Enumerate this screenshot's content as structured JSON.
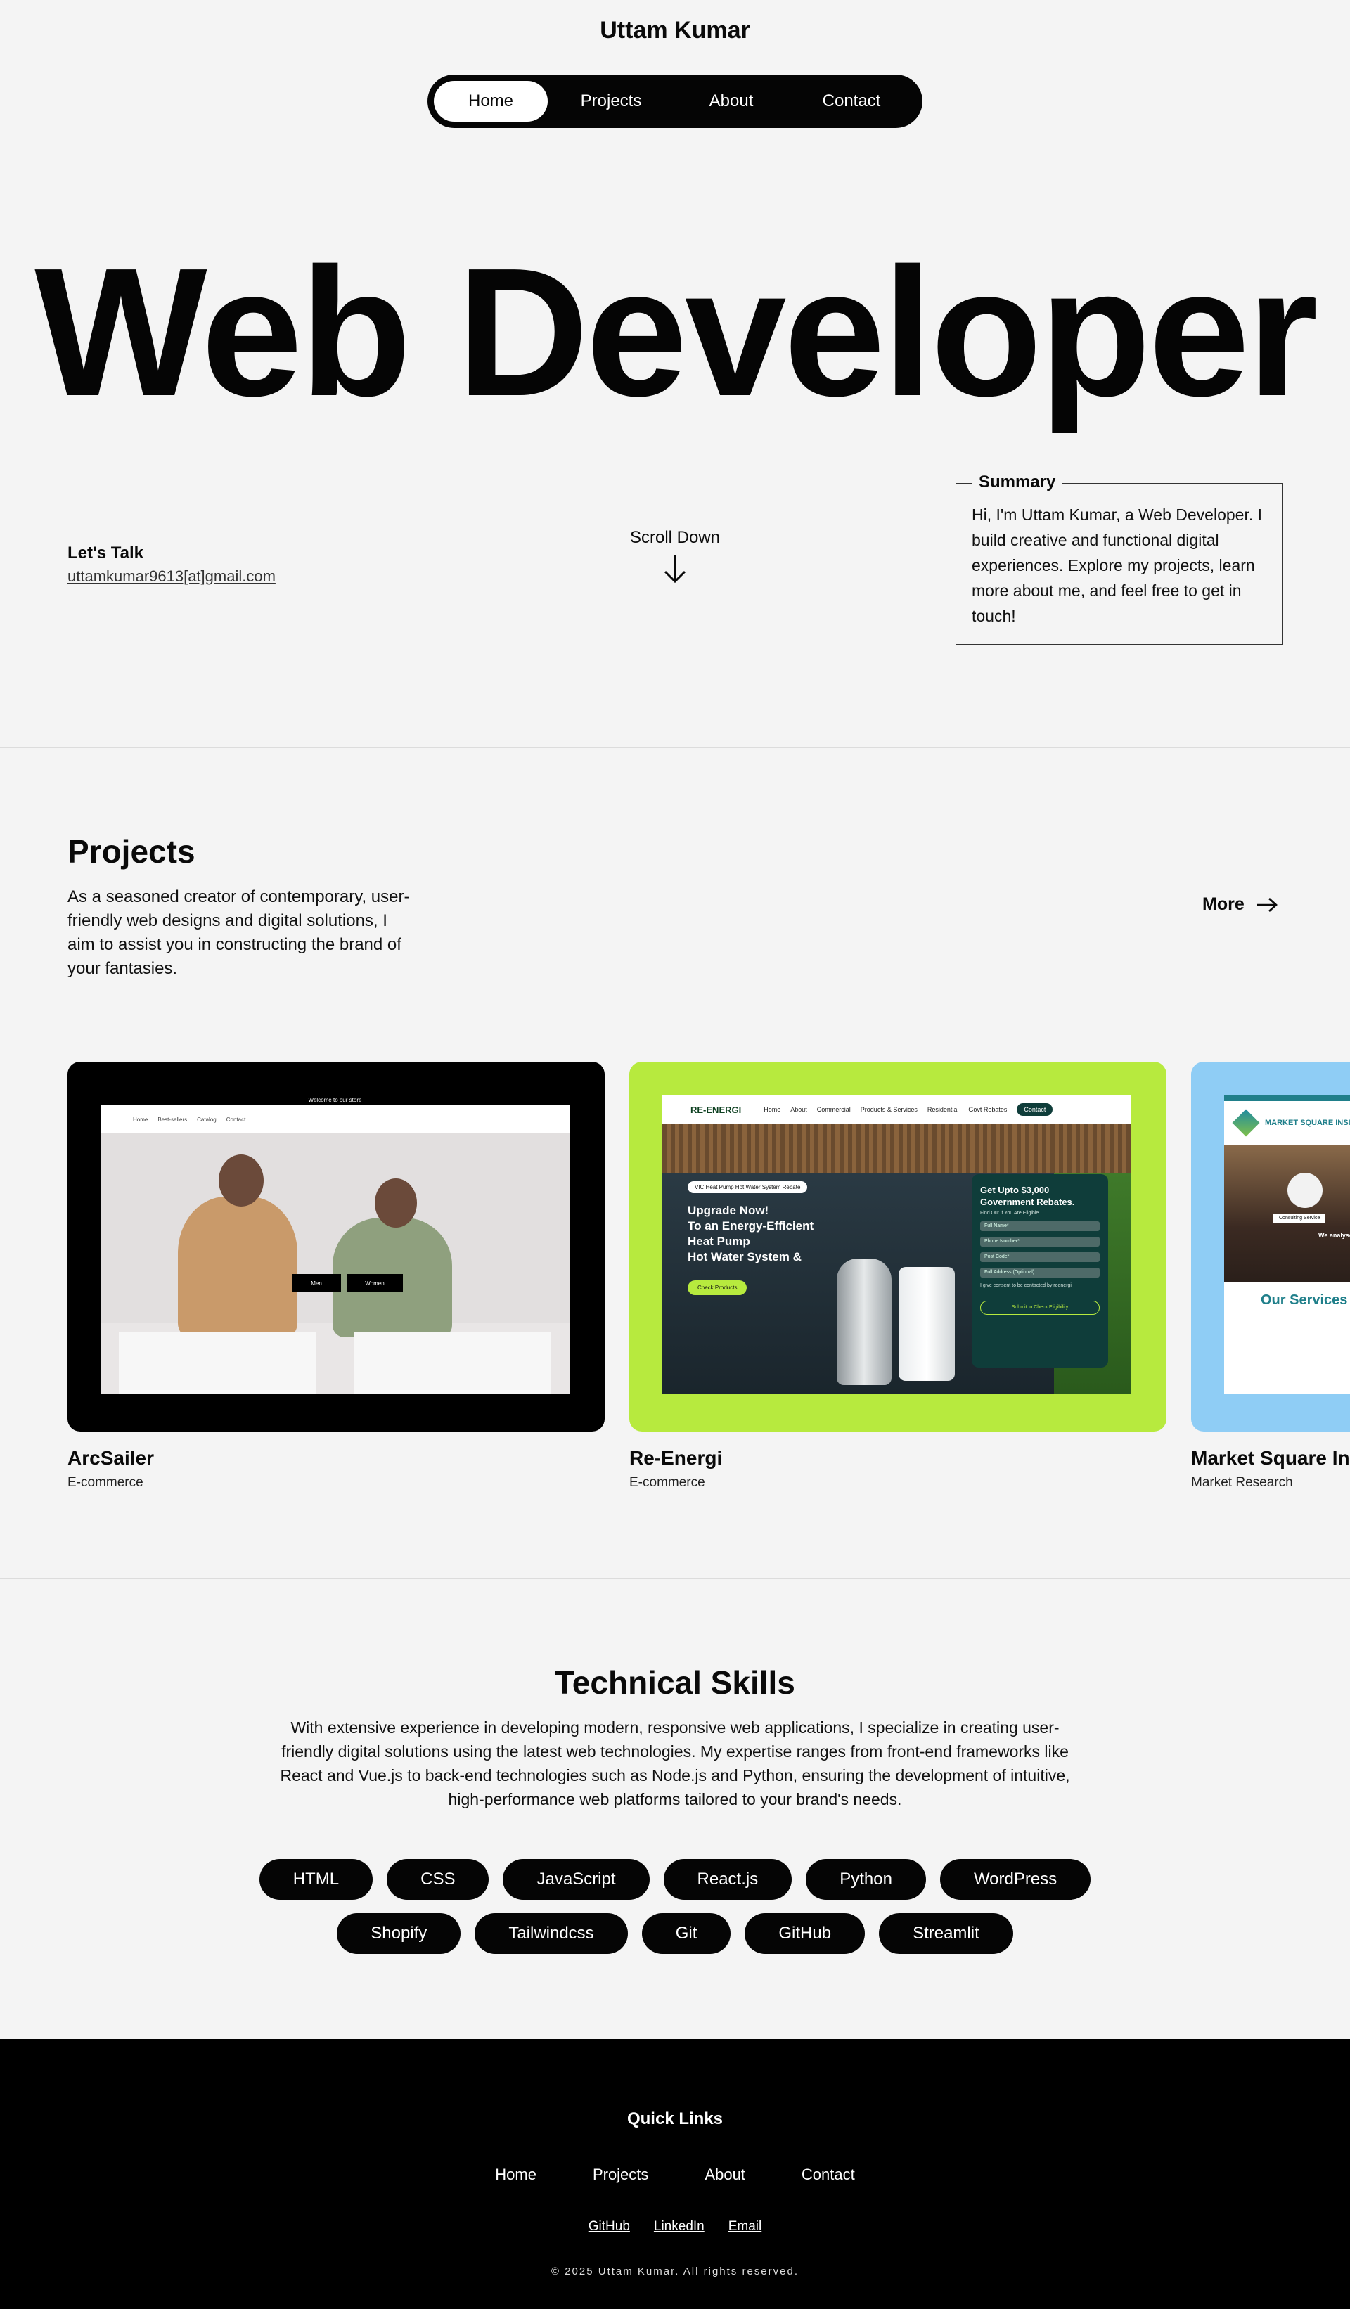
{
  "header": {
    "site_title": "Uttam Kumar",
    "nav": [
      {
        "label": "Home",
        "active": true
      },
      {
        "label": "Projects",
        "active": false
      },
      {
        "label": "About",
        "active": false
      },
      {
        "label": "Contact",
        "active": false
      }
    ]
  },
  "hero": {
    "title": "Web Developer",
    "lets_talk_label": "Let's Talk",
    "email": "uttamkumar9613[at]gmail.com",
    "scroll_label": "Scroll Down",
    "summary_legend": "Summary",
    "summary_text": "Hi, I'm Uttam Kumar, a Web Developer. I build creative and functional digital experiences. Explore my projects, learn more about me, and feel free to get in touch!"
  },
  "projects": {
    "title": "Projects",
    "description": "As a seasoned creator of contemporary, user-friendly web designs and digital solutions, I aim to assist you in constructing the brand of your fantasies.",
    "more_label": "More",
    "items": [
      {
        "name": "ArcSailer",
        "category": "E-commerce",
        "bg": "#000000"
      },
      {
        "name": "Re-Energi",
        "category": "E-commerce",
        "bg": "#b7ea3e"
      },
      {
        "name": "Market Square Ins",
        "category": "Market Research",
        "bg": "#8fcdf5"
      }
    ],
    "arcsailer_screen": {
      "topbar": "Welcome to our store",
      "nav": [
        "Home",
        "Best-sellers",
        "Catalog",
        "Contact"
      ],
      "button_men": "Men",
      "button_women": "Women"
    },
    "reenergi_screen": {
      "logo": "RE-ENERGI",
      "nav": [
        "Home",
        "About",
        "Commercial",
        "Products & Services",
        "Residential",
        "Govt Rebates"
      ],
      "contact_btn": "Contact",
      "chip": "VIC Heat Pump Hot Water System Rebate",
      "headline_1": "Upgrade Now!",
      "headline_2": "To an Energy-Efficient",
      "headline_3": "Heat Pump",
      "headline_4": "Hot Water System &",
      "check_btn": "Check Products",
      "form_heading": "Get Upto $3,000 Government Rebates.",
      "form_sub": "Find Out If You Are Eligible",
      "fields": [
        "Full Name*",
        "Phone Number*",
        "Post Code*",
        "Full Address (Optional)"
      ],
      "consent": "I give consent to be contacted by reenergi",
      "submit": "Submit to Check Eligibility"
    },
    "market_screen": {
      "logo": "MARKET SQUARE INSIGHTS",
      "badge": "Consulting Service",
      "tagline": "We analyse",
      "services": "Our Services"
    }
  },
  "skills": {
    "title": "Technical Skills",
    "description": "With extensive experience in developing modern, responsive web applications, I specialize in creating user-friendly digital solutions using the latest web technologies. My expertise ranges from front-end frameworks like React and Vue.js to back-end technologies such as Node.js and Python, ensuring the development of intuitive, high-performance web platforms tailored to your brand's needs.",
    "row1": [
      "HTML",
      "CSS",
      "JavaScript",
      "React.js",
      "Python",
      "WordPress"
    ],
    "row2": [
      "Shopify",
      "Tailwindcss",
      "Git",
      "GitHub",
      "Streamlit"
    ]
  },
  "footer": {
    "quick_links_title": "Quick Links",
    "nav": [
      "Home",
      "Projects",
      "About",
      "Contact"
    ],
    "social": [
      "GitHub",
      "LinkedIn",
      "Email"
    ],
    "copyright": "© 2025 Uttam Kumar. All rights reserved."
  },
  "colors": {
    "background": "#f4f4f4",
    "dark": "#050505",
    "lime": "#b7ea3e",
    "sky": "#8fcdf5",
    "teal": "#1f7f8a"
  },
  "icons": {
    "scroll": "arrow-down-icon",
    "more": "arrow-right-icon"
  }
}
